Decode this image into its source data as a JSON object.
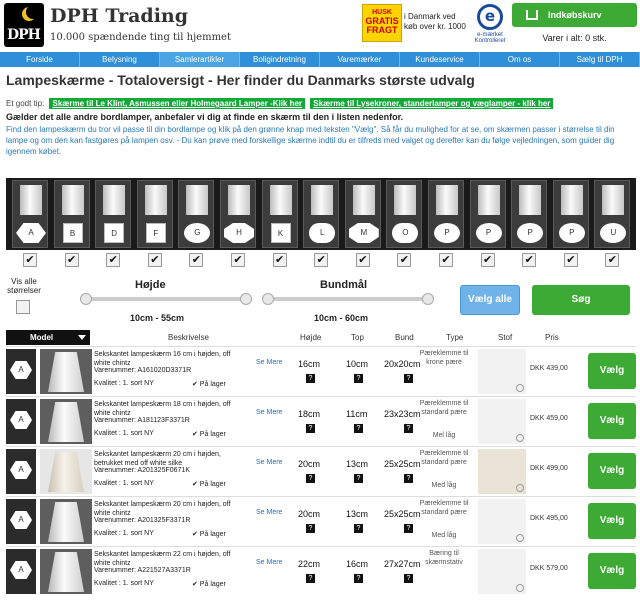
{
  "header": {
    "logo_text": "DPH",
    "brand": "DPH Trading",
    "tagline": "10.000 spændende ting til hjemmet",
    "gratis_top": "HUSK",
    "gratis_main": "GRATIS FRAGT",
    "shipping_note": "i Danmark ved køb over kr. 1000",
    "emaerke_label": "e-mærket Kontrolleret",
    "cart_button": "Indkøbskurv",
    "cart_count": "Varer i alt: 0 stk."
  },
  "nav": [
    "Forside",
    "Belysning",
    "Samlerartikler",
    "Boligindretning",
    "Varemærker",
    "Kundeservice",
    "Om os",
    "Sælg til DPH"
  ],
  "page": {
    "title": "Lampeskærme - Totaloversigt - Her finder du Danmarks største udvalg",
    "tip_label": "Et godt tip:",
    "tip_link_1": "Skærme til Le Klint, Asmussen eller Holmegaard Lamper -Klik her",
    "tip_link_2": "Skærme til Lysekroner, standerlamper og væglamper - klik her",
    "note_bold": "Gælder det alle andre bordlamper, anbefaler vi dig at finde en skærm til den i listen nedenfor.",
    "note_text": "Find den lampeskærm du tror vil passe til din bordlampe og klik på den grønne knap med teksten \"Vælg\". Så får du mulighed for at se, om skærmen passer i størrelse til din lampe og om den kan fastgøres på lampen osv. - Du kan prøve med forskellige skærme indtil du er tilfreds med valget og derefter kan du følge vejledningen, som guider dig igennem købet."
  },
  "shapes": [
    {
      "label": "A",
      "style": "hx"
    },
    {
      "label": "B",
      "style": "sq"
    },
    {
      "label": "D",
      "style": "sq"
    },
    {
      "label": "F",
      "style": "sq"
    },
    {
      "label": "G",
      "style": "rd"
    },
    {
      "label": "H",
      "style": "oc"
    },
    {
      "label": "K",
      "style": "sq"
    },
    {
      "label": "L",
      "style": "pl"
    },
    {
      "label": "M",
      "style": "oc"
    },
    {
      "label": "O",
      "style": "pl"
    },
    {
      "label": "P",
      "style": "rd"
    },
    {
      "label": "P",
      "style": "rd"
    },
    {
      "label": "P",
      "style": "rd"
    },
    {
      "label": "P",
      "style": "rd"
    },
    {
      "label": "U",
      "style": "rd"
    }
  ],
  "filter": {
    "check_mark": "✔",
    "all_sizes_label": "Vis alle størrelser",
    "height_title": "Højde",
    "height_range": "10cm - 55cm",
    "bottom_title": "Bundmål",
    "bottom_range": "10cm - 60cm",
    "select_all": "Vælg alle",
    "search": "Søg"
  },
  "table_headers": {
    "model": "Model",
    "beskrivelse": "Beskrivelse",
    "hojde": "Højde",
    "top": "Top",
    "bund": "Bund",
    "type": "Type",
    "stof": "Stof",
    "pris": "Pris"
  },
  "rows": [
    {
      "model": "A",
      "desc": "Sekskantet lampeskærm 16 cm i højden, off white chintz",
      "varenr": "Varenummer: A161020D3371R",
      "kval": "Kvalitet : 1. sort  NY",
      "lager": "✔ På lager",
      "semere": "Se Mere",
      "hojde": "16cm",
      "top": "10cm",
      "bund": "20x20cm",
      "type": "Pæreklemme til krone pære",
      "mere": "",
      "pris": "DKK 439,00",
      "vaelg": "Vælg",
      "light": false
    },
    {
      "model": "A",
      "desc": "Sekskantet lampeskærm 18 cm i højden, off white chintz",
      "varenr": "Varenummer: A181123F3371R",
      "kval": "Kvalitet : 1. sort  NY",
      "lager": "✔ På lager",
      "semere": "Se Mere",
      "hojde": "18cm",
      "top": "11cm",
      "bund": "23x23cm",
      "type": "Pæreklemme til standard pære",
      "mere": "Mel låg",
      "pris": "DKK 459,00",
      "vaelg": "Vælg",
      "light": false
    },
    {
      "model": "A",
      "desc": "Sekskantet lampeskærm 20 cm i højden, betrukket med off white silke",
      "varenr": "Varenummer: A201325F0671K",
      "kval": "Kvalitet : 1. sort  NY",
      "lager": "✔ På lager",
      "semere": "Se Mere",
      "hojde": "20cm",
      "top": "13cm",
      "bund": "25x25cm",
      "type": "Pæreklemme til standard pære",
      "mere": "Med låg",
      "pris": "DKK 499,00",
      "vaelg": "Vælg",
      "light": true
    },
    {
      "model": "A",
      "desc": "Sekskantet lampeskærm 20 cm i højden, off white chintz",
      "varenr": "Varenummer: A201325F3371R",
      "kval": "Kvalitet : 1. sort  NY",
      "lager": "✔ På lager",
      "semere": "Se Mere",
      "hojde": "20cm",
      "top": "13cm",
      "bund": "25x25cm",
      "type": "Pæreklemme til standard pære",
      "mere": "Med låg",
      "pris": "DKK 495,00",
      "vaelg": "Vælg",
      "light": false
    },
    {
      "model": "A",
      "desc": "Sekskantet lampeskærm 22 cm i højden, off white chintz",
      "varenr": "Varenummer: A221527A3371R",
      "kval": "Kvalitet : 1. sort  NY",
      "lager": "✔ På lager",
      "semere": "Se Mere",
      "hojde": "22cm",
      "top": "16cm",
      "bund": "27x27cm",
      "type": "Bæring til skærmstativ",
      "mere": "",
      "pris": "DKK 579,00",
      "vaelg": "Vælg",
      "light": false
    }
  ]
}
